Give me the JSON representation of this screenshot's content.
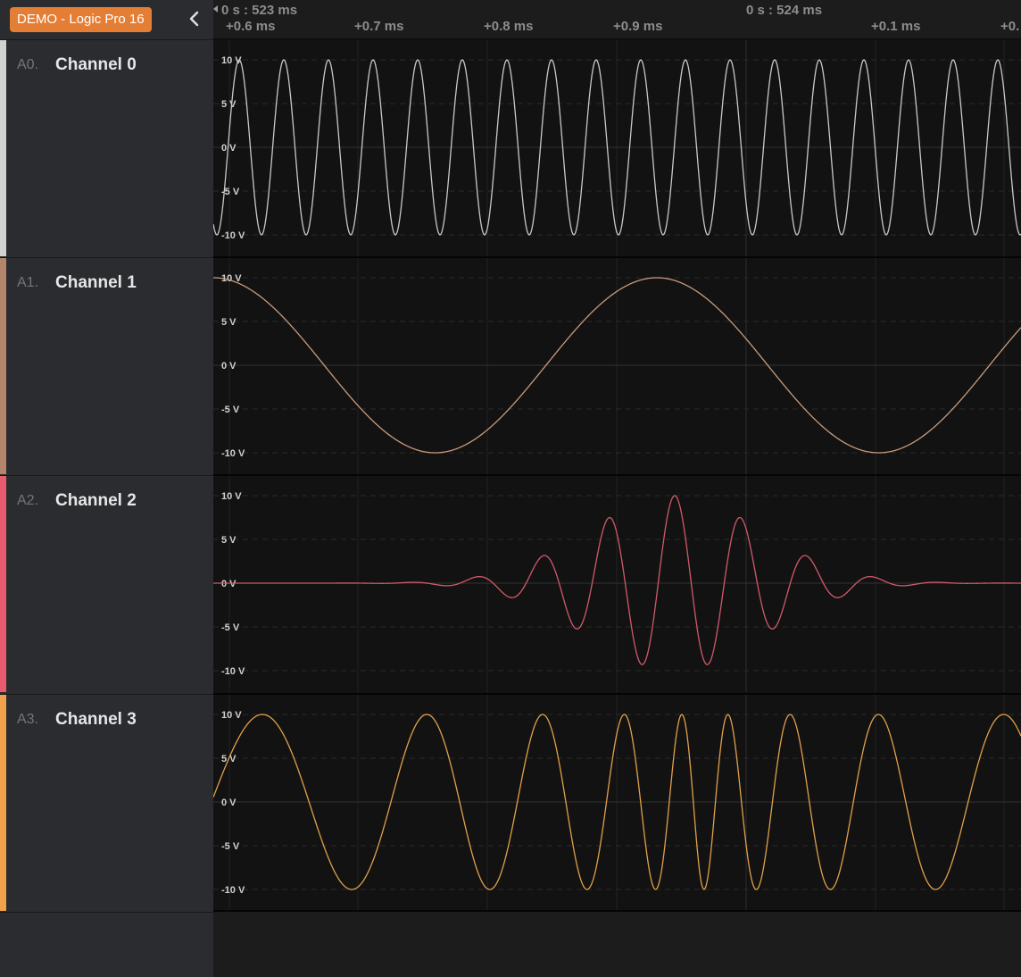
{
  "device_badge": "DEMO - Logic Pro 16",
  "icons": {
    "collapse": "chevron-left-icon",
    "scroll_left": "triangle-left-icon"
  },
  "timeline": {
    "markers": [
      {
        "label": "0 s : 523 ms",
        "kind": "major"
      },
      {
        "label": "0 s : 524 ms",
        "kind": "major"
      }
    ],
    "ticks": [
      "+0.6 ms",
      "+0.7 ms",
      "+0.8 ms",
      "+0.9 ms",
      "+0.1 ms",
      "+0."
    ]
  },
  "channels": [
    {
      "id": "A0.",
      "name": "Channel 0",
      "color": "#d2d2d2",
      "wave_color": "#c8c8c8",
      "y_ticks": [
        "10 V",
        "5 V",
        "0 V",
        "-5 V",
        "-10 V"
      ]
    },
    {
      "id": "A1.",
      "name": "Channel 1",
      "color": "#b3856a",
      "wave_color": "#c99a7c",
      "y_ticks": [
        "10 V",
        "5 V",
        "0 V",
        "-5 V",
        "-10 V"
      ]
    },
    {
      "id": "A2.",
      "name": "Channel 2",
      "color": "#e95b6e",
      "wave_color": "#d05a6a",
      "y_ticks": [
        "10 V",
        "5 V",
        "0 V",
        "-5 V",
        "-10 V"
      ]
    },
    {
      "id": "A3.",
      "name": "Channel 3",
      "color": "#f0a14a",
      "wave_color": "#e0a04a",
      "y_ticks": [
        "10 V",
        "5 V",
        "0 V",
        "-5 V",
        "-10 V"
      ]
    }
  ]
}
